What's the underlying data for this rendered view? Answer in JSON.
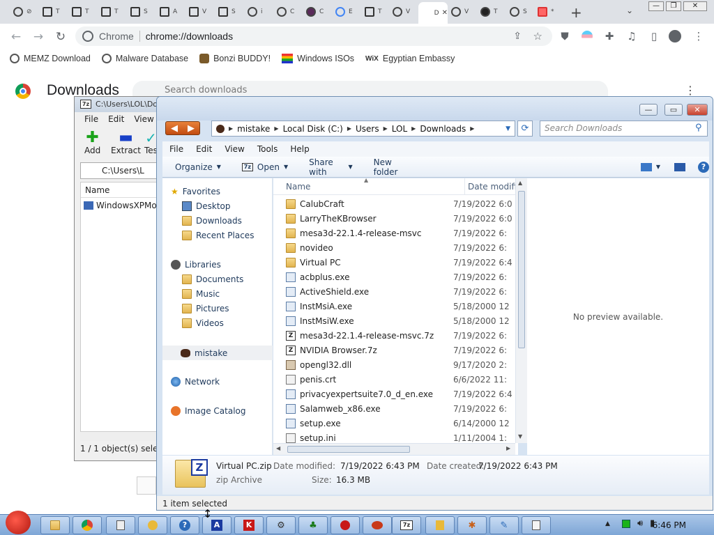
{
  "browser": {
    "tabs": [
      {
        "label": "⊘",
        "icon": "blocked-icon"
      },
      {
        "label": "T",
        "icon": "generic-page-icon"
      },
      {
        "label": "T",
        "icon": "generic-page-icon"
      },
      {
        "label": "T",
        "icon": "generic-page-icon"
      },
      {
        "label": "S",
        "icon": "generic-page-icon"
      },
      {
        "label": "A",
        "icon": "generic-page-icon"
      },
      {
        "label": "V",
        "icon": "generic-page-icon"
      },
      {
        "label": "S",
        "icon": "generic-page-icon"
      },
      {
        "label": "i",
        "icon": "globe-icon"
      },
      {
        "label": "C",
        "icon": "blocked-icon"
      },
      {
        "label": "C",
        "icon": "bonzi-icon"
      },
      {
        "label": "E",
        "icon": "google-icon"
      },
      {
        "label": "T",
        "icon": "generic-page-icon"
      },
      {
        "label": "V",
        "icon": "globe-icon"
      },
      {
        "label": "D",
        "icon": "downloads-icon",
        "active": true
      },
      {
        "label": "V",
        "icon": "globe-icon"
      },
      {
        "label": "T",
        "icon": "github-icon"
      },
      {
        "label": "S",
        "icon": "globe-icon"
      },
      {
        "label": "*",
        "icon": "red-page-icon"
      }
    ],
    "new_tab": "+",
    "omnibox": {
      "host": "Chrome",
      "url": "chrome://downloads"
    },
    "bookmarks": [
      {
        "label": "MEMZ Download",
        "icon": "globe-icon"
      },
      {
        "label": "Malware Database",
        "icon": "globe-icon"
      },
      {
        "label": "Bonzi BUDDY!",
        "icon": "bonzi-icon"
      },
      {
        "label": "Windows ISOs",
        "icon": "windows-flag-icon"
      },
      {
        "label": "Egyptian Embassy",
        "icon": "wix-icon"
      }
    ],
    "page_title": "Downloads",
    "search_placeholder": "Search downloads"
  },
  "zip_window": {
    "title": "C:\\Users\\LOL\\Do",
    "menu": [
      "File",
      "Edit",
      "View"
    ],
    "buttons": [
      "Add",
      "Extract",
      "Tes"
    ],
    "path": "C:\\Users\\L",
    "column": "Name",
    "file": "WindowsXPMod",
    "status": "1 / 1 object(s) selecte"
  },
  "explorer": {
    "breadcrumbs": [
      "mistake",
      "Local Disk (C:)",
      "Users",
      "LOL",
      "Downloads"
    ],
    "search_placeholder": "Search Downloads",
    "menu": [
      "File",
      "Edit",
      "View",
      "Tools",
      "Help"
    ],
    "commands": {
      "organize": "Organize",
      "open": "Open",
      "share": "Share with",
      "new_folder": "New folder"
    },
    "nav": {
      "favorites": "Favorites",
      "favorites_items": [
        "Desktop",
        "Downloads",
        "Recent Places"
      ],
      "libraries": "Libraries",
      "libraries_items": [
        "Documents",
        "Music",
        "Pictures",
        "Videos"
      ],
      "computer": "mistake",
      "network": "Network",
      "image_catalog": "Image Catalog"
    },
    "columns": {
      "name": "Name",
      "date": "Date modifie"
    },
    "files": [
      {
        "name": "CalubCraft",
        "date": "7/19/2022 6:0",
        "type": "folder"
      },
      {
        "name": "LarryTheKBrowser",
        "date": "7/19/2022 6:0",
        "type": "folder"
      },
      {
        "name": "mesa3d-22.1.4-release-msvc",
        "date": "7/19/2022 6:",
        "type": "folder"
      },
      {
        "name": "novideo",
        "date": "7/19/2022 6:",
        "type": "folder"
      },
      {
        "name": "Virtual PC",
        "date": "7/19/2022 6:4",
        "type": "folder"
      },
      {
        "name": "acbplus.exe",
        "date": "7/19/2022 6:",
        "type": "exe"
      },
      {
        "name": "ActiveShield.exe",
        "date": "7/19/2022 6:",
        "type": "exe"
      },
      {
        "name": "InstMsiA.exe",
        "date": "5/18/2000 12",
        "type": "exe"
      },
      {
        "name": "InstMsiW.exe",
        "date": "5/18/2000 12",
        "type": "exe"
      },
      {
        "name": "mesa3d-22.1.4-release-msvc.7z",
        "date": "7/19/2022 6:",
        "type": "7z"
      },
      {
        "name": "NVIDIA Browser.7z",
        "date": "7/19/2022 6:",
        "type": "7z"
      },
      {
        "name": "opengl32.dll",
        "date": "9/17/2020 2:",
        "type": "dll"
      },
      {
        "name": "penis.crt",
        "date": "6/6/2022 11:",
        "type": "crt"
      },
      {
        "name": "privacyexpertsuite7.0_d_en.exe",
        "date": "7/19/2022 6:4",
        "type": "exe"
      },
      {
        "name": "Salamweb_x86.exe",
        "date": "7/19/2022 6:",
        "type": "exe"
      },
      {
        "name": "setup.exe",
        "date": "6/14/2000 12",
        "type": "exe"
      },
      {
        "name": "setup.ini",
        "date": "1/11/2004 1:",
        "type": "crt"
      }
    ],
    "preview": "No preview available.",
    "details": {
      "name": "Virtual PC.zip",
      "type": "zip Archive",
      "modified_label": "Date modified:",
      "modified": "7/19/2022 6:43 PM",
      "created_label": "Date created:",
      "created": "7/19/2022 6:43 PM",
      "size_label": "Size:",
      "size": "16.3 MB"
    },
    "status": "1 item selected"
  },
  "taskbar": {
    "clock": "6:46 PM"
  }
}
